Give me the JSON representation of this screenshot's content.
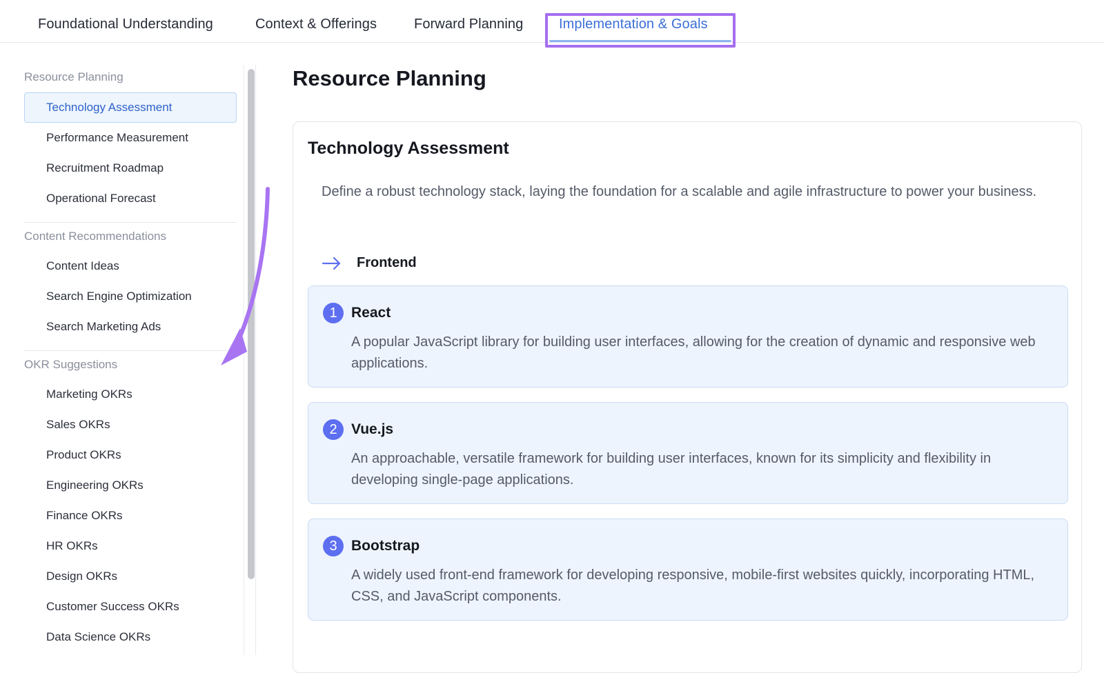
{
  "tabs": [
    {
      "label": "Foundational Understanding"
    },
    {
      "label": "Context & Offerings"
    },
    {
      "label": "Forward Planning"
    },
    {
      "label": "Implementation & Goals"
    }
  ],
  "sidebar": {
    "sections": [
      {
        "title": "Resource Planning",
        "items": [
          "Technology Assessment",
          "Performance Measurement",
          "Recruitment Roadmap",
          "Operational Forecast"
        ]
      },
      {
        "title": "Content Recommendations",
        "items": [
          "Content Ideas",
          "Search Engine Optimization",
          "Search Marketing Ads"
        ]
      },
      {
        "title": "OKR Suggestions",
        "items": [
          "Marketing OKRs",
          "Sales OKRs",
          "Product OKRs",
          "Engineering OKRs",
          "Finance OKRs",
          "HR OKRs",
          "Design OKRs",
          "Customer Success OKRs",
          "Data Science OKRs"
        ]
      }
    ]
  },
  "main": {
    "page_title": "Resource Planning",
    "card": {
      "title": "Technology Assessment",
      "description": "Define a robust technology stack, laying the foundation for a scalable and agile infrastructure to power your business.",
      "section_label": "Frontend",
      "items": [
        {
          "number": "1",
          "title": "React",
          "description": "A popular JavaScript library for building user interfaces, allowing for the creation of dynamic and responsive web applications."
        },
        {
          "number": "2",
          "title": "Vue.js",
          "description": "An approachable, versatile framework for building user interfaces, known for its simplicity and flexibility in developing single-page applications."
        },
        {
          "number": "3",
          "title": "Bootstrap",
          "description": "A widely used front-end framework for developing responsive, mobile-first websites quickly, incorporating HTML, CSS, and JavaScript components."
        }
      ]
    }
  },
  "colors": {
    "accent": "#3b6fd8",
    "highlight": "#a56ef0",
    "badge": "#5d6ff0",
    "item_bg": "#eef4fd"
  }
}
